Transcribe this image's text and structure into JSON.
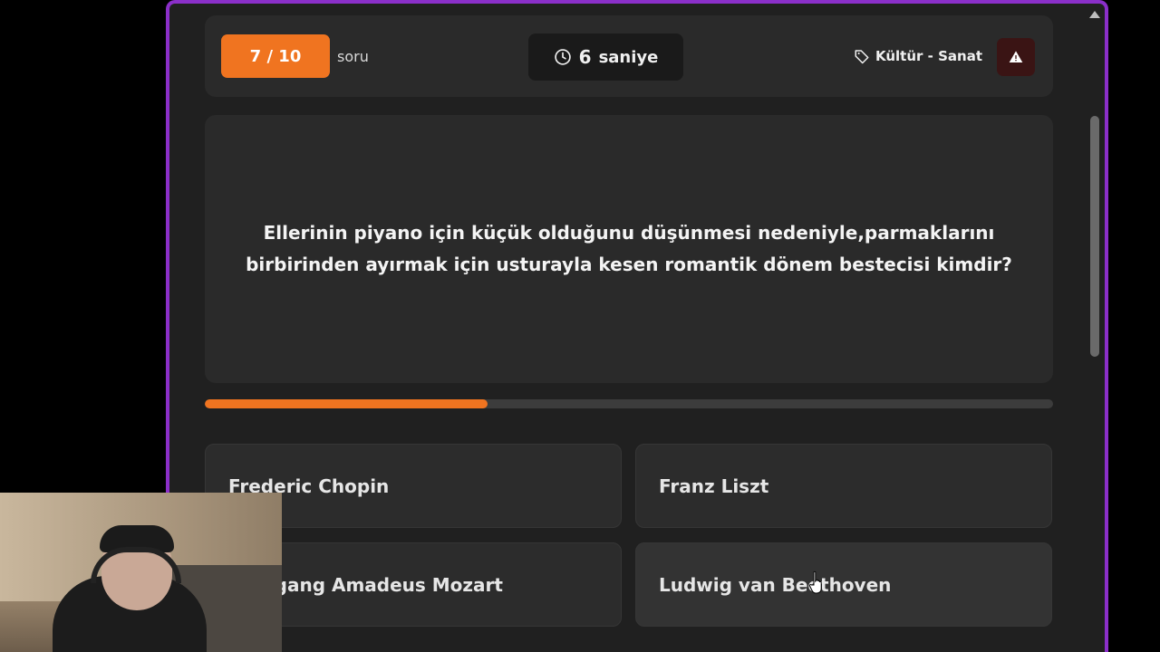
{
  "header": {
    "counter": "7 / 10",
    "counter_label": "soru",
    "timer_value": "6",
    "timer_unit": "saniye",
    "category": "Kültür - Sanat"
  },
  "question": {
    "text": "Ellerinin piyano için küçük olduğunu düşünmesi nedeniyle,parmaklarını birbirinden ayırmak için usturayla kesen romantik dönem bestecisi kimdir?"
  },
  "progress": {
    "fraction": 0.333
  },
  "answers": [
    {
      "label": "Frederic Chopin"
    },
    {
      "label": "Franz Liszt"
    },
    {
      "label": "Wolfgang Amadeus Mozart"
    },
    {
      "label": "Ludwig van Beethoven"
    }
  ],
  "colors": {
    "accent": "#f07420",
    "frame": "#8b2fc9",
    "background": "#202020",
    "card": "#2a2a2a",
    "report": "#3a1414"
  },
  "icons": {
    "timer": "clock-icon",
    "category": "tag-icon",
    "report": "warning-icon"
  }
}
